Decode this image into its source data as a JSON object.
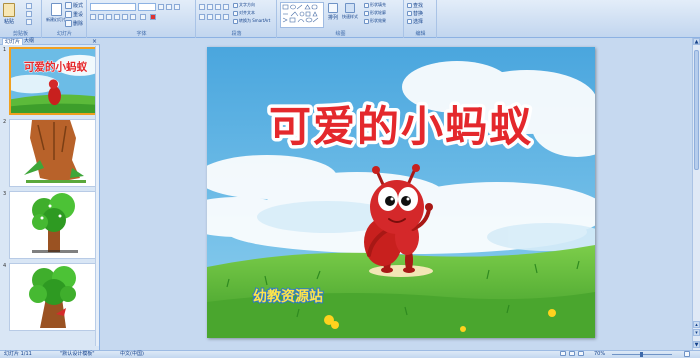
{
  "ribbon": {
    "groups": [
      {
        "label": "剪贴板"
      },
      {
        "label": "幻灯片"
      },
      {
        "label": "字体"
      },
      {
        "label": "段落"
      },
      {
        "label": "绘图"
      },
      {
        "label": "编辑"
      }
    ],
    "paste": "粘贴",
    "new_slide": "新建幻灯片",
    "layout": "版式",
    "reset": "重设",
    "delete": "删除",
    "text_direction": "文字方向",
    "align_text": "对齐文本",
    "smartart": "转换为 SmartArt",
    "arrange": "排列",
    "quick_styles": "快速样式",
    "shape_fill": "形状填充",
    "shape_outline": "形状轮廓",
    "shape_effects": "形状效果",
    "find": "查找",
    "replace": "替换",
    "select": "选择"
  },
  "left_panel": {
    "tabs": [
      "幻灯片",
      "大纲"
    ],
    "close": "×",
    "thumbs": [
      {
        "num": "1"
      },
      {
        "num": "2"
      },
      {
        "num": "3"
      },
      {
        "num": "4"
      }
    ]
  },
  "slide": {
    "title": "可爱的小蚂蚁",
    "logo": "幼教资源站"
  },
  "status": {
    "slide_info": "幻灯片 1/11",
    "theme": "\"默认设计模板\"",
    "language": "中文(中国)",
    "zoom": "70%"
  },
  "colors": {
    "title_red": "#e4282c",
    "sky_blue": "#5fb3e2",
    "grass_green": "#58b838",
    "ant_red": "#c8201e"
  }
}
